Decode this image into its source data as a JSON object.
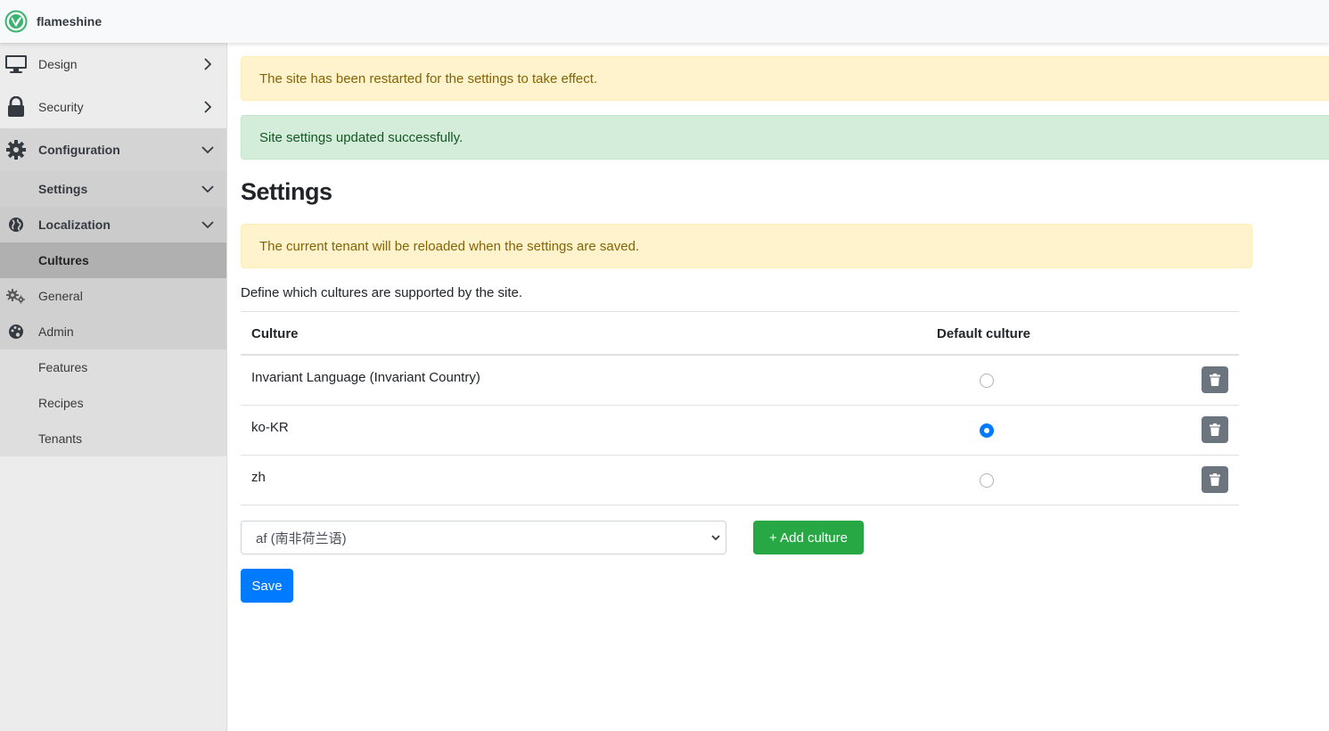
{
  "brand": {
    "name": "flameshine"
  },
  "sidebar": {
    "design": "Design",
    "security": "Security",
    "configuration": "Configuration",
    "settings": "Settings",
    "localization": "Localization",
    "cultures": "Cultures",
    "general": "General",
    "admin": "Admin",
    "features": "Features",
    "recipes": "Recipes",
    "tenants": "Tenants"
  },
  "alerts": {
    "restart": "The site has been restarted for the settings to take effect.",
    "updated": "Site settings updated successfully.",
    "tenant": "The current tenant will be reloaded when the settings are saved."
  },
  "page": {
    "title": "Settings",
    "hint": "Define which cultures are supported by the site."
  },
  "table": {
    "col_culture": "Culture",
    "col_default": "Default culture",
    "rows": [
      {
        "name": "Invariant Language (Invariant Country)",
        "default": false
      },
      {
        "name": "ko-KR",
        "default": true
      },
      {
        "name": "zh",
        "default": false
      }
    ]
  },
  "form": {
    "selected_culture": "af (南非荷兰语)",
    "add_label": "+ Add culture",
    "save_label": "Save"
  },
  "colors": {
    "primary": "#007bff",
    "success": "#28a745",
    "secondary": "#6c757d",
    "warning_bg": "#fff3cd",
    "success_bg": "#d4edda"
  }
}
